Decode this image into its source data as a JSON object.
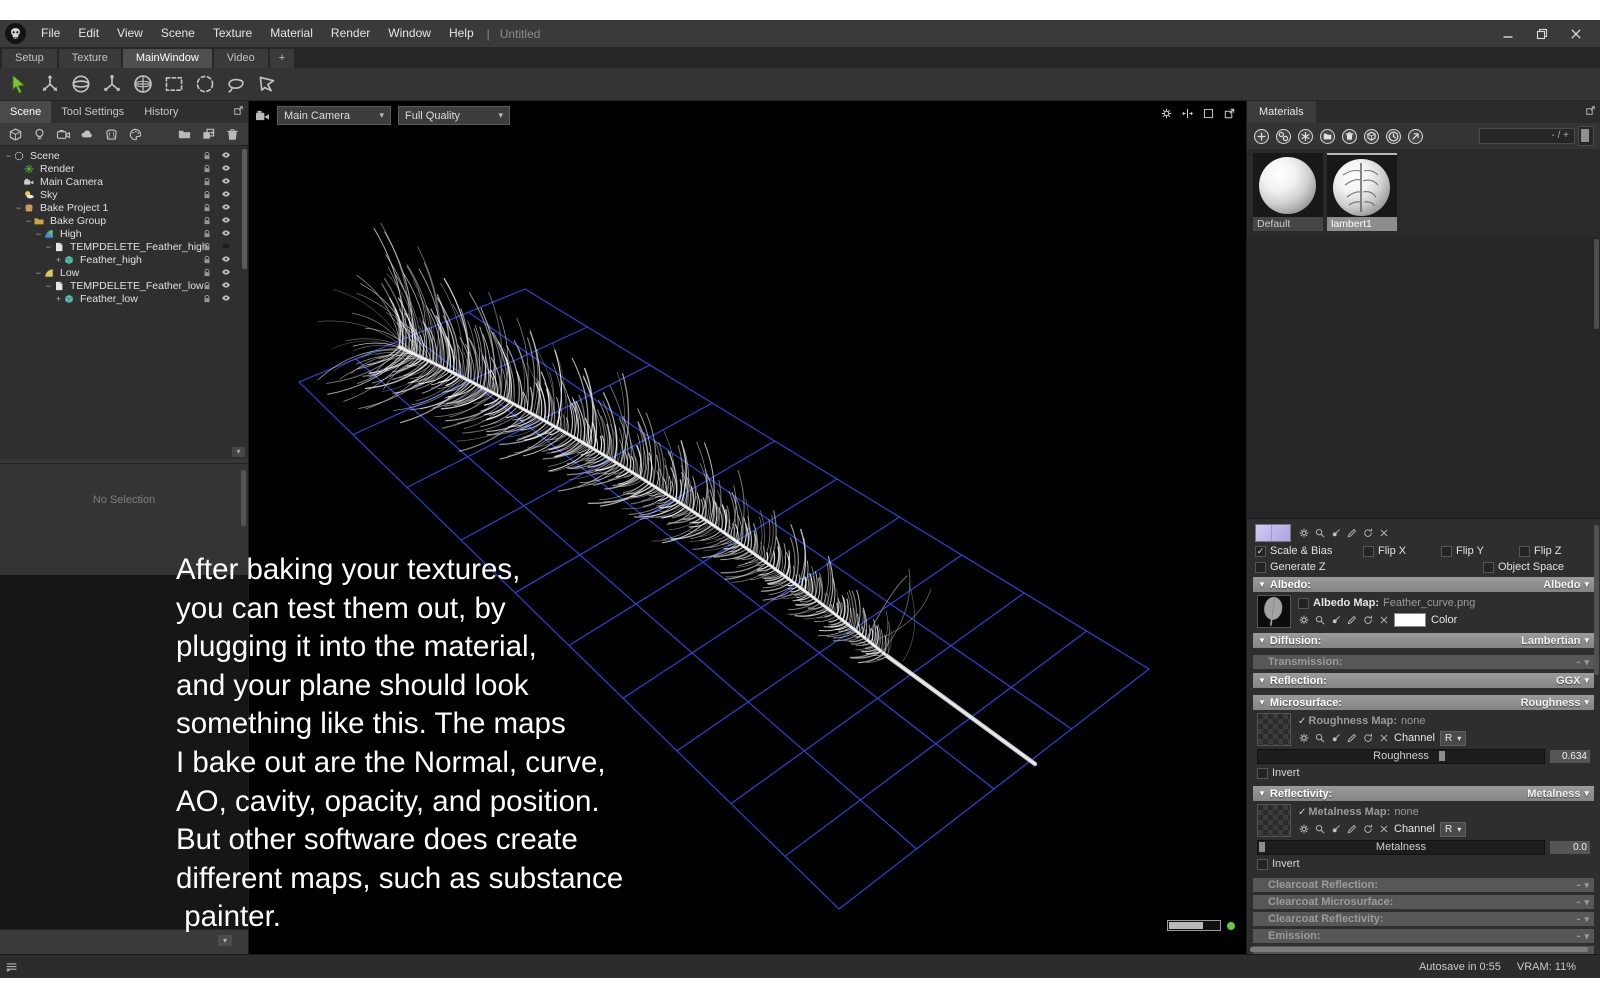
{
  "titlebar": {
    "menus": [
      "File",
      "Edit",
      "View",
      "Scene",
      "Texture",
      "Material",
      "Render",
      "Window",
      "Help"
    ],
    "separator": "|",
    "document_title": "Untitled"
  },
  "doc_tabs": {
    "items": [
      "Setup",
      "Texture",
      "MainWindow",
      "Video"
    ],
    "active": "MainWindow",
    "add_tab": "+"
  },
  "main_toolbar": {
    "tools": [
      "select",
      "translate",
      "rotate",
      "scale",
      "universal-manipulator",
      "box-select",
      "circle-select",
      "lasso-select",
      "polygon-select"
    ]
  },
  "left_panel": {
    "tabs": [
      "Scene",
      "Tool Settings",
      "History"
    ],
    "active_tab": "Scene",
    "toolbar": [
      "mesh",
      "light",
      "camera",
      "sky",
      "bake",
      "material",
      "folder",
      "duplicate",
      "delete"
    ],
    "tree": [
      {
        "label": "Scene",
        "depth": 0,
        "icon": "scene",
        "expander": "-",
        "eye": "open"
      },
      {
        "label": "Render",
        "depth": 1,
        "icon": "render",
        "expander": "",
        "eye": "open"
      },
      {
        "label": "Main Camera",
        "depth": 1,
        "icon": "camera",
        "expander": "",
        "eye": "open"
      },
      {
        "label": "Sky",
        "depth": 1,
        "icon": "sky",
        "expander": "",
        "eye": "open"
      },
      {
        "label": "Bake Project 1",
        "depth": 1,
        "icon": "bake",
        "expander": "-",
        "eye": "open"
      },
      {
        "label": "Bake Group",
        "depth": 2,
        "icon": "folder",
        "expander": "-",
        "eye": "open"
      },
      {
        "label": "High",
        "depth": 3,
        "icon": "fan-high",
        "expander": "-",
        "eye": "open"
      },
      {
        "label": "TEMPDELETE_Feather_high",
        "depth": 4,
        "icon": "page",
        "expander": "-",
        "eye": "closed"
      },
      {
        "label": "Feather_high",
        "depth": 5,
        "icon": "mesh",
        "expander": "+",
        "eye": "open"
      },
      {
        "label": "Low",
        "depth": 3,
        "icon": "fan-low",
        "expander": "-",
        "eye": "open"
      },
      {
        "label": "TEMPDELETE_Feather_low",
        "depth": 4,
        "icon": "page",
        "expander": "-",
        "eye": "open"
      },
      {
        "label": "Feather_low",
        "depth": 5,
        "icon": "mesh",
        "expander": "+",
        "eye": "open"
      }
    ],
    "no_selection_text": "No Selection"
  },
  "viewport": {
    "camera_select": "Main Camera",
    "quality_select": "Full Quality",
    "corner_tools": [
      "settings",
      "split-view",
      "maximize",
      "popout"
    ],
    "caption_lines": [
      "After baking your textures,",
      "you can test them out, by",
      "plugging it into the material,",
      "and your plane should look",
      "something like this. The maps",
      "I bake out are the Normal, curve,",
      "AO, cavity, opacity, and position.",
      "But other software does create",
      "different maps, such as substance",
      " painter."
    ]
  },
  "materials_panel": {
    "title": "Materials",
    "toolbar": [
      "add",
      "instance",
      "clear",
      "folder",
      "delete",
      "assign",
      "history",
      "locate"
    ],
    "size_control_label": "- / +",
    "items": [
      {
        "label": "Default",
        "selected": false
      },
      {
        "label": "lambert1",
        "selected": true
      }
    ]
  },
  "properties": {
    "texture": {
      "scale_bias": "Scale & Bias",
      "flip_x": "Flip X",
      "flip_y": "Flip Y",
      "flip_z": "Flip Z",
      "generate_z": "Generate Z",
      "object_space": "Object Space"
    },
    "albedo": {
      "header": "Albedo:",
      "mode": "Albedo",
      "map_label": "Albedo Map:",
      "map_file": "Feather_curve.png",
      "color_label": "Color"
    },
    "diffusion": {
      "header": "Diffusion:",
      "mode": "Lambertian"
    },
    "transmission": {
      "header": "Transmission:",
      "mode": "-"
    },
    "reflection": {
      "header": "Reflection:",
      "mode": "GGX"
    },
    "microsurface": {
      "header": "Microsurface:",
      "mode": "Roughness",
      "map_label": "Roughness Map:",
      "map_value": "none",
      "channel_label": "Channel",
      "channel_value": "R",
      "slider_label": "Roughness",
      "slider_value": "0.634",
      "invert_label": "Invert"
    },
    "reflectivity": {
      "header": "Reflectivity:",
      "mode": "Metalness",
      "map_label": "Metalness Map:",
      "map_value": "none",
      "channel_label": "Channel",
      "channel_value": "R",
      "slider_label": "Metalness",
      "slider_value": "0.0",
      "invert_label": "Invert"
    },
    "clearcoat_reflection": {
      "header": "Clearcoat Reflection:",
      "mode": "-"
    },
    "clearcoat_microsurface": {
      "header": "Clearcoat Microsurface:",
      "mode": "-"
    },
    "clearcoat_reflectivity": {
      "header": "Clearcoat Reflectivity:",
      "mode": "-"
    },
    "emission": {
      "header": "Emission:",
      "mode": "-"
    }
  },
  "statusbar": {
    "autosave": "Autosave in 0:55",
    "vram": "VRAM: 11%"
  },
  "colors": {
    "accent_green": "#7ec23d",
    "grid_blue": "#2c49e0",
    "material_selected": "#8d8d8d"
  }
}
